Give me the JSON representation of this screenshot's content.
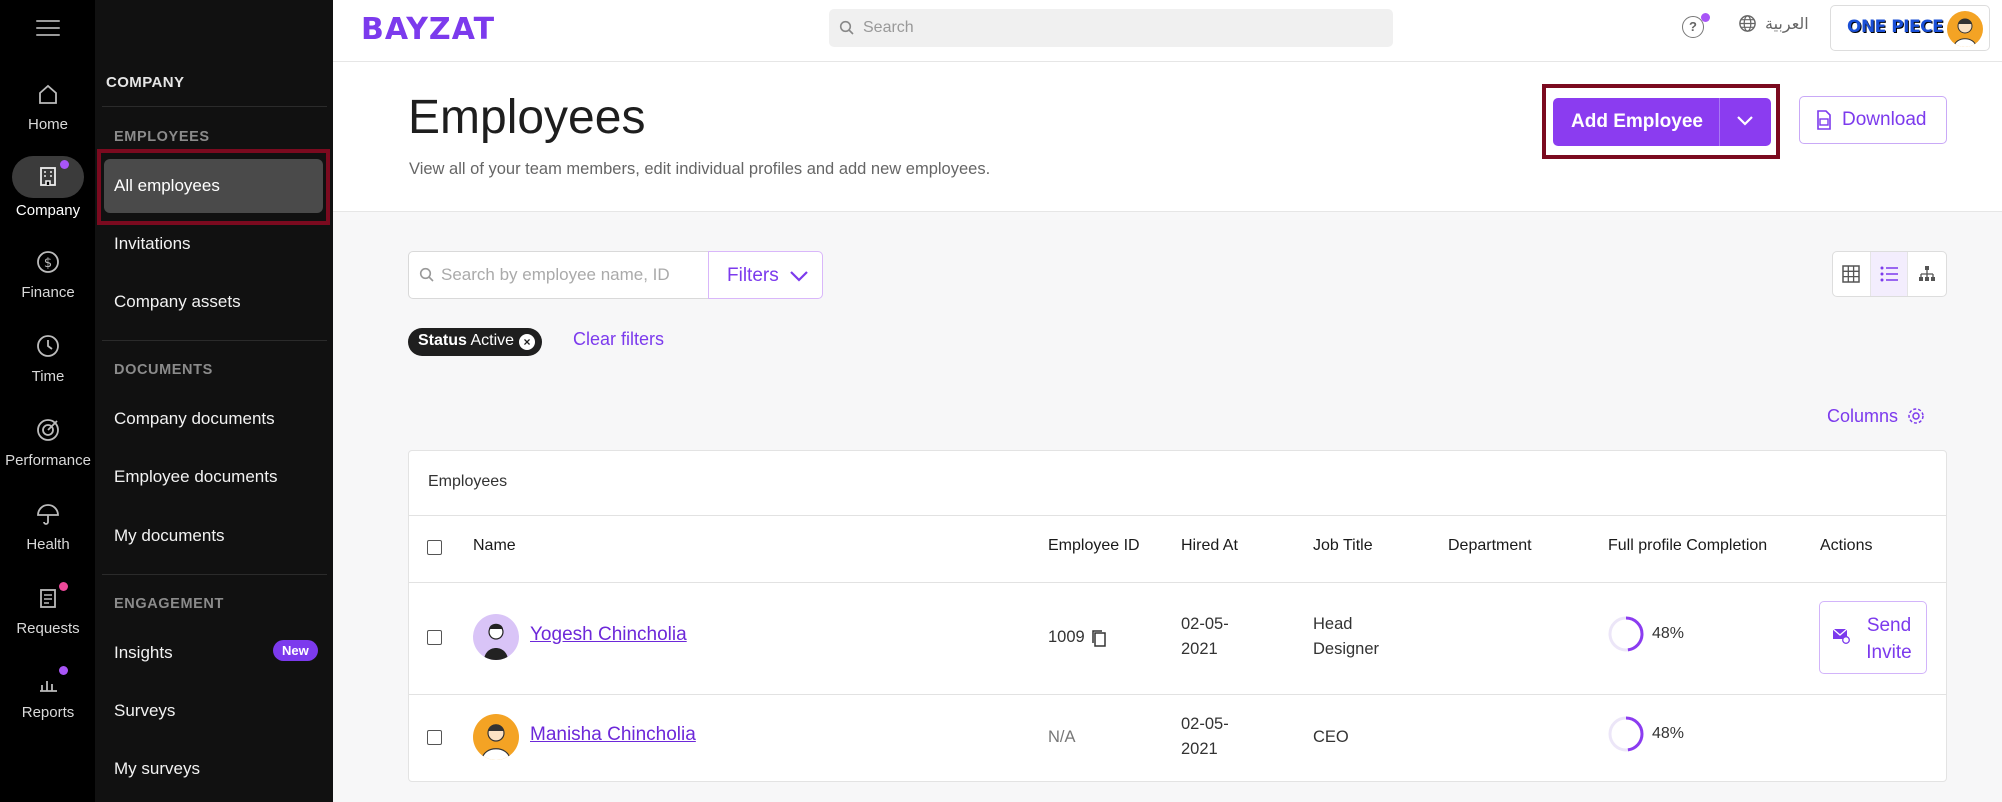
{
  "rail": {
    "items": [
      {
        "label": "Home",
        "icon": "home-icon"
      },
      {
        "label": "Company",
        "icon": "building-icon"
      },
      {
        "label": "Finance",
        "icon": "dollar-icon"
      },
      {
        "label": "Time",
        "icon": "clock-icon"
      },
      {
        "label": "Performance",
        "icon": "target-icon"
      },
      {
        "label": "Health",
        "icon": "umbrella-icon"
      },
      {
        "label": "Requests",
        "icon": "clipboard-icon"
      },
      {
        "label": "Reports",
        "icon": "chart-icon"
      }
    ]
  },
  "subnav": {
    "company": "COMPANY",
    "sections": {
      "employees": "EMPLOYEES",
      "documents": "DOCUMENTS",
      "engagement": "ENGAGEMENT"
    },
    "items": {
      "all_employees": "All employees",
      "invitations": "Invitations",
      "company_assets": "Company assets",
      "company_documents": "Company documents",
      "employee_documents": "Employee documents",
      "my_documents": "My documents",
      "insights": "Insights",
      "insights_badge": "New",
      "surveys": "Surveys",
      "my_surveys": "My surveys"
    }
  },
  "topbar": {
    "logo": "BAYZAT",
    "search_placeholder": "Search",
    "language": "العربية",
    "brand": "ONE PIECE"
  },
  "header": {
    "title": "Employees",
    "subtitle": "View all of your team members, edit individual profiles and add new employees.",
    "add_label": "Add Employee",
    "download_label": "Download"
  },
  "toolbar": {
    "search_placeholder": "Search by employee name, ID",
    "filters_label": "Filters",
    "chip_key": "Status",
    "chip_value": "Active",
    "clear_label": "Clear filters",
    "columns_label": "Columns"
  },
  "table": {
    "caption": "Employees",
    "headers": {
      "name": "Name",
      "employee_id": "Employee ID",
      "hired_at": "Hired At",
      "job_title": "Job Title",
      "department": "Department",
      "completion": "Full profile Completion",
      "actions": "Actions"
    },
    "rows": [
      {
        "name": "Yogesh Chincholia",
        "employee_id": "1009",
        "hired_line1": "02-05-",
        "hired_line2": "2021",
        "job_line1": "Head",
        "job_line2": "Designer",
        "department": "",
        "completion": "48%",
        "completion_value": 0.48,
        "action_line1": "Send",
        "action_line2": "Invite"
      },
      {
        "name": "Manisha Chincholia",
        "employee_id": "N/A",
        "hired_line1": "02-05-",
        "hired_line2": "2021",
        "job_line1": "CEO",
        "job_line2": "",
        "department": "",
        "completion": "48%",
        "completion_value": 0.48
      }
    ]
  },
  "colors": {
    "accent": "#7c3aed",
    "highlight": "#7b0a1f"
  }
}
